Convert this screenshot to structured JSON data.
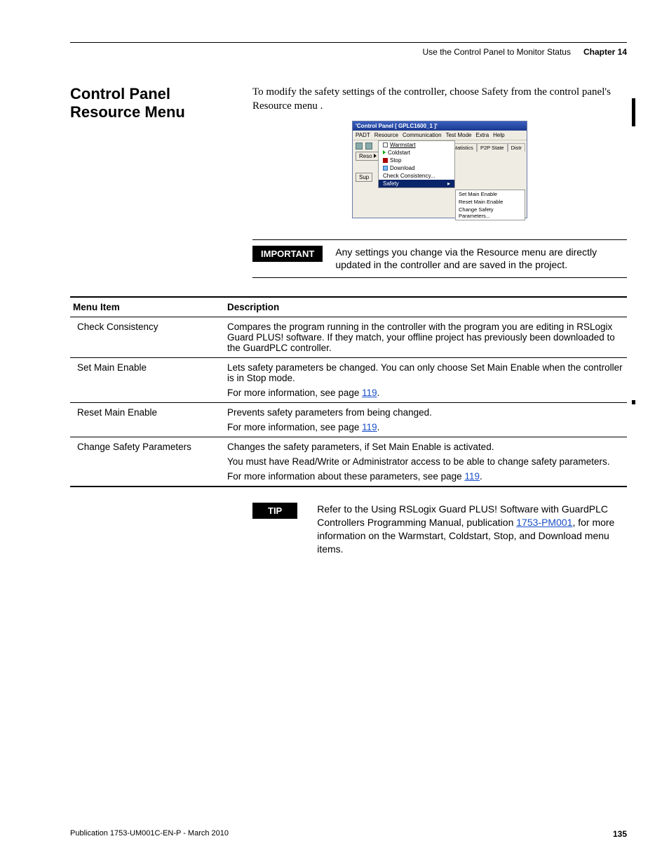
{
  "header": {
    "running_head": "Use the Control Panel to Monitor Status",
    "chapter": "Chapter 14"
  },
  "section_title": "Control Panel Resource Menu",
  "intro": "To modify the safety settings of the controller, choose Safety from the control panel's Resource menu .",
  "screenshot": {
    "titlebar": "'Control Panel [ GPLC1600_1 ]'",
    "menubar": [
      "PADT",
      "Resource",
      "Communication",
      "Test Mode",
      "Extra",
      "Help"
    ],
    "left_buttons": [
      "Reso",
      "Sup"
    ],
    "dropdown": [
      {
        "icon": "play-green",
        "label": "Warmstart"
      },
      {
        "icon": "play-green",
        "label": "Coldstart"
      },
      {
        "icon": "stop-red",
        "label": "Stop"
      },
      {
        "icon": "download",
        "label": "Download"
      },
      {
        "icon": "",
        "label": "Check Consistency..."
      },
      {
        "icon": "",
        "label": "Safety",
        "highlight": true,
        "submenu_arrow": true
      }
    ],
    "submenu": [
      "Set Main Enable",
      "Reset Main Enable",
      "Change Safety Parameters..."
    ],
    "tabs": [
      "s",
      "Statistics",
      "P2P State",
      "Distr"
    ]
  },
  "important": {
    "label": "IMPORTANT",
    "text": "Any settings you change via the Resource menu are directly updated in the controller and are saved in the project."
  },
  "table": {
    "col1": "Menu Item",
    "col2": "Description",
    "rows": [
      {
        "item": "Check Consistency",
        "desc": [
          "Compares the program running in the controller with the program you are editing in RSLogix Guard PLUS! software. If they match, your offline project has previously been downloaded to the GuardPLC controller."
        ]
      },
      {
        "item": "Set Main Enable",
        "desc": [
          "Lets safety parameters be changed. You can only choose Set Main Enable when the controller is in Stop mode.",
          "For more information, see page {link:119}."
        ]
      },
      {
        "item": "Reset Main Enable",
        "desc": [
          "Prevents safety parameters from being changed.",
          "For more information, see page {link:119}."
        ]
      },
      {
        "item": "Change Safety Parameters",
        "desc": [
          "Changes the safety parameters, if Set Main Enable is activated.",
          "You must have Read/Write or Administrator access to be able to change safety parameters.",
          "For more information about these parameters, see page {link:119}."
        ]
      }
    ]
  },
  "tip": {
    "label": "TIP",
    "text_before": "Refer to the Using RSLogix Guard PLUS! Software with GuardPLC Controllers Programming Manual, publication ",
    "link_text": "1753-PM001",
    "text_after": ", for more information on the Warmstart, Coldstart, Stop, and Download menu items."
  },
  "footer": {
    "pub": "Publication 1753-UM001C-EN-P - March 2010",
    "page": "135"
  },
  "links": {
    "p119": "119"
  }
}
